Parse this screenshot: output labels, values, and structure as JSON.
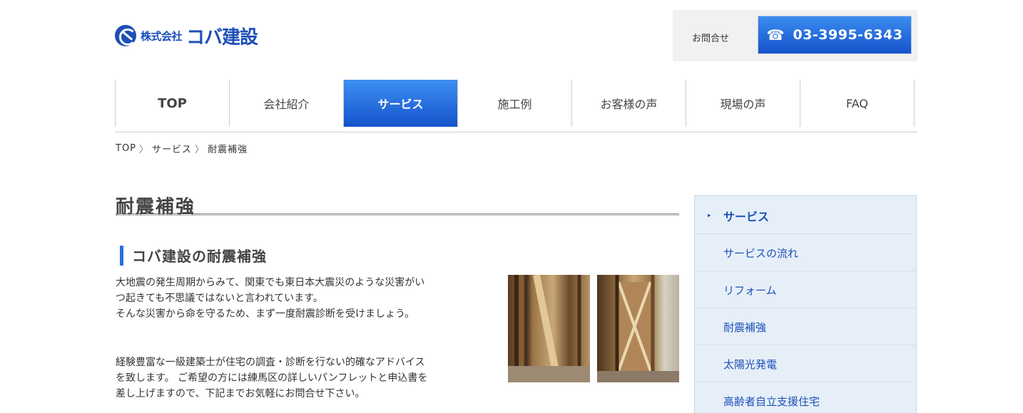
{
  "header": {
    "logo": {
      "small": "株式会社",
      "big": "コバ建設"
    },
    "contact_label": "お問合せ",
    "phone": "03-3995-6343"
  },
  "nav": {
    "items": [
      {
        "label": "TOP"
      },
      {
        "label": "会社紹介"
      },
      {
        "label": "サービス"
      },
      {
        "label": "施工例"
      },
      {
        "label": "お客様の声"
      },
      {
        "label": "現場の声"
      },
      {
        "label": "FAQ"
      }
    ]
  },
  "breadcrumb": [
    "TOP",
    "サービス",
    "耐震補強"
  ],
  "main": {
    "title": "耐震補強",
    "section_title": "コバ建設の耐震補強",
    "paragraph1": [
      "大地震の発生周期からみて、関東でも東日本大震災のような災害がい",
      "つ起きても不思議ではないと言われています。",
      "そんな災害から命を守るため、まず一度耐震診断を受けましょう。"
    ],
    "paragraph2": [
      "経験豊富な一級建築士が住宅の調査・診断を行ない的確なアドバイス",
      "を致します。 ご希望の方には練馬区の詳しいパンフレットと申込書を",
      "差し上げますので、下記までお気軽にお問合せ下さい。"
    ]
  },
  "sidebar": {
    "heading": "サービス",
    "items": [
      "サービスの流れ",
      "リフォーム",
      "耐震補強",
      "太陽光発電",
      "高齢者自立支援住宅"
    ]
  },
  "colors": {
    "accent": "#1d4fb8",
    "nav_active": "#1553cc",
    "sidebar_bg": "#e6eff8"
  }
}
